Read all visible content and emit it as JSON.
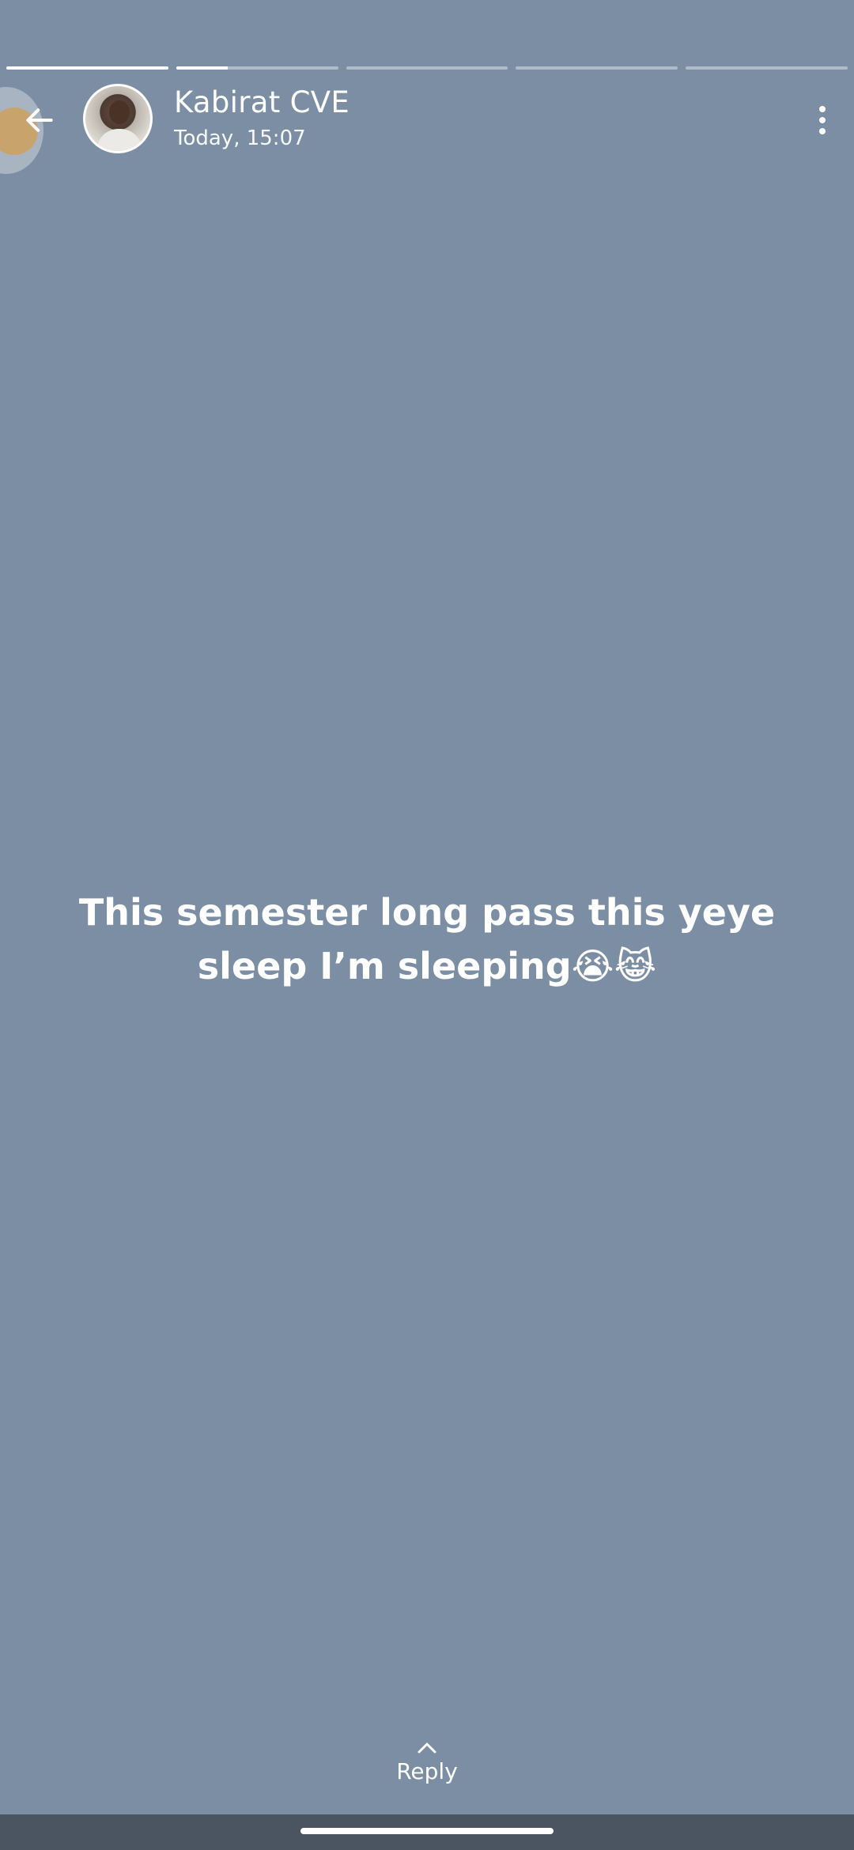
{
  "status": {
    "segments": [
      {
        "progress": 1.0
      },
      {
        "progress": 0.32
      },
      {
        "progress": 0.0
      },
      {
        "progress": 0.0
      },
      {
        "progress": 0.0
      }
    ],
    "contact_name": "Kabirat CVE",
    "timestamp": "Today, 15:07",
    "text": "This semester long pass this yeye sleep I’m sleeping😭😹",
    "background_color": "#7c8ea3"
  },
  "icons": {
    "back": "arrow-left-icon",
    "menu": "more-vert-icon",
    "reply": "chevron-up-icon"
  },
  "footer": {
    "reply_label": "Reply"
  }
}
